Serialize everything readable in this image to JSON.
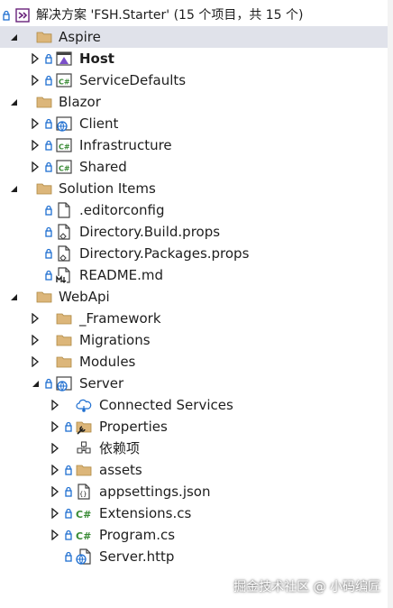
{
  "solution": {
    "title": "解决方案 'FSH.Starter' (15 个项目，共 15 个)",
    "folders": {
      "aspire": "Aspire",
      "blazor": "Blazor",
      "solution_items": "Solution Items",
      "webapi": "WebApi"
    },
    "projects": {
      "host": "Host",
      "service_defaults": "ServiceDefaults",
      "client": "Client",
      "infrastructure": "Infrastructure",
      "shared": "Shared"
    },
    "solution_files": {
      "editorconfig": ".editorconfig",
      "build_props": "Directory.Build.props",
      "packages_props": "Directory.Packages.props",
      "readme": "README.md"
    },
    "webapi_items": {
      "framework": "_Framework",
      "migrations": "Migrations",
      "modules": "Modules",
      "server": "Server"
    },
    "server_items": {
      "connected_services": "Connected Services",
      "properties": "Properties",
      "dependencies": "依赖项",
      "assets": "assets",
      "appsettings": "appsettings.json",
      "extensions": "Extensions.cs",
      "program": "Program.cs",
      "server_http": "Server.http"
    }
  },
  "watermark": "掘金技术社区 @ 小码编匠",
  "colors": {
    "selected_row": "#e0e2ea",
    "lock": "#1f6fd1",
    "folder": "#dcb67a",
    "csharp": "#388a34",
    "solution_purple": "#68217a"
  }
}
